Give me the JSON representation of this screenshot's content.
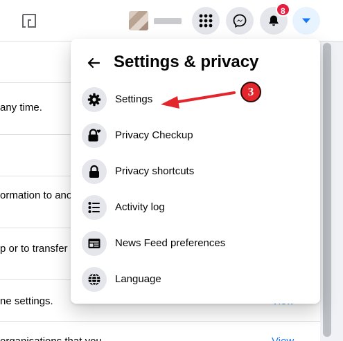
{
  "topbar": {
    "notification_count": "8",
    "icons": [
      "ghost-square-icon",
      "menu-grid-icon",
      "messenger-icon",
      "bell-icon",
      "caret-down-icon"
    ]
  },
  "background": {
    "rows": [
      {
        "text": "any time.",
        "link": ""
      },
      {
        "text": "ormation to anot",
        "link": ""
      },
      {
        "text": "p or to transfer to",
        "link": ""
      },
      {
        "text": "ne settings.",
        "link": "View"
      },
      {
        "text": "organisations that you",
        "link": "View"
      }
    ]
  },
  "panel": {
    "title": "Settings & privacy",
    "items": [
      {
        "label": "Settings",
        "icon": "gear-icon"
      },
      {
        "label": "Privacy Checkup",
        "icon": "lock-heart-icon"
      },
      {
        "label": "Privacy shortcuts",
        "icon": "lock-icon"
      },
      {
        "label": "Activity log",
        "icon": "list-icon"
      },
      {
        "label": "News Feed preferences",
        "icon": "news-feed-icon"
      },
      {
        "label": "Language",
        "icon": "globe-icon"
      }
    ]
  },
  "annotation": {
    "step_number": "3",
    "color": "#e3262b"
  }
}
